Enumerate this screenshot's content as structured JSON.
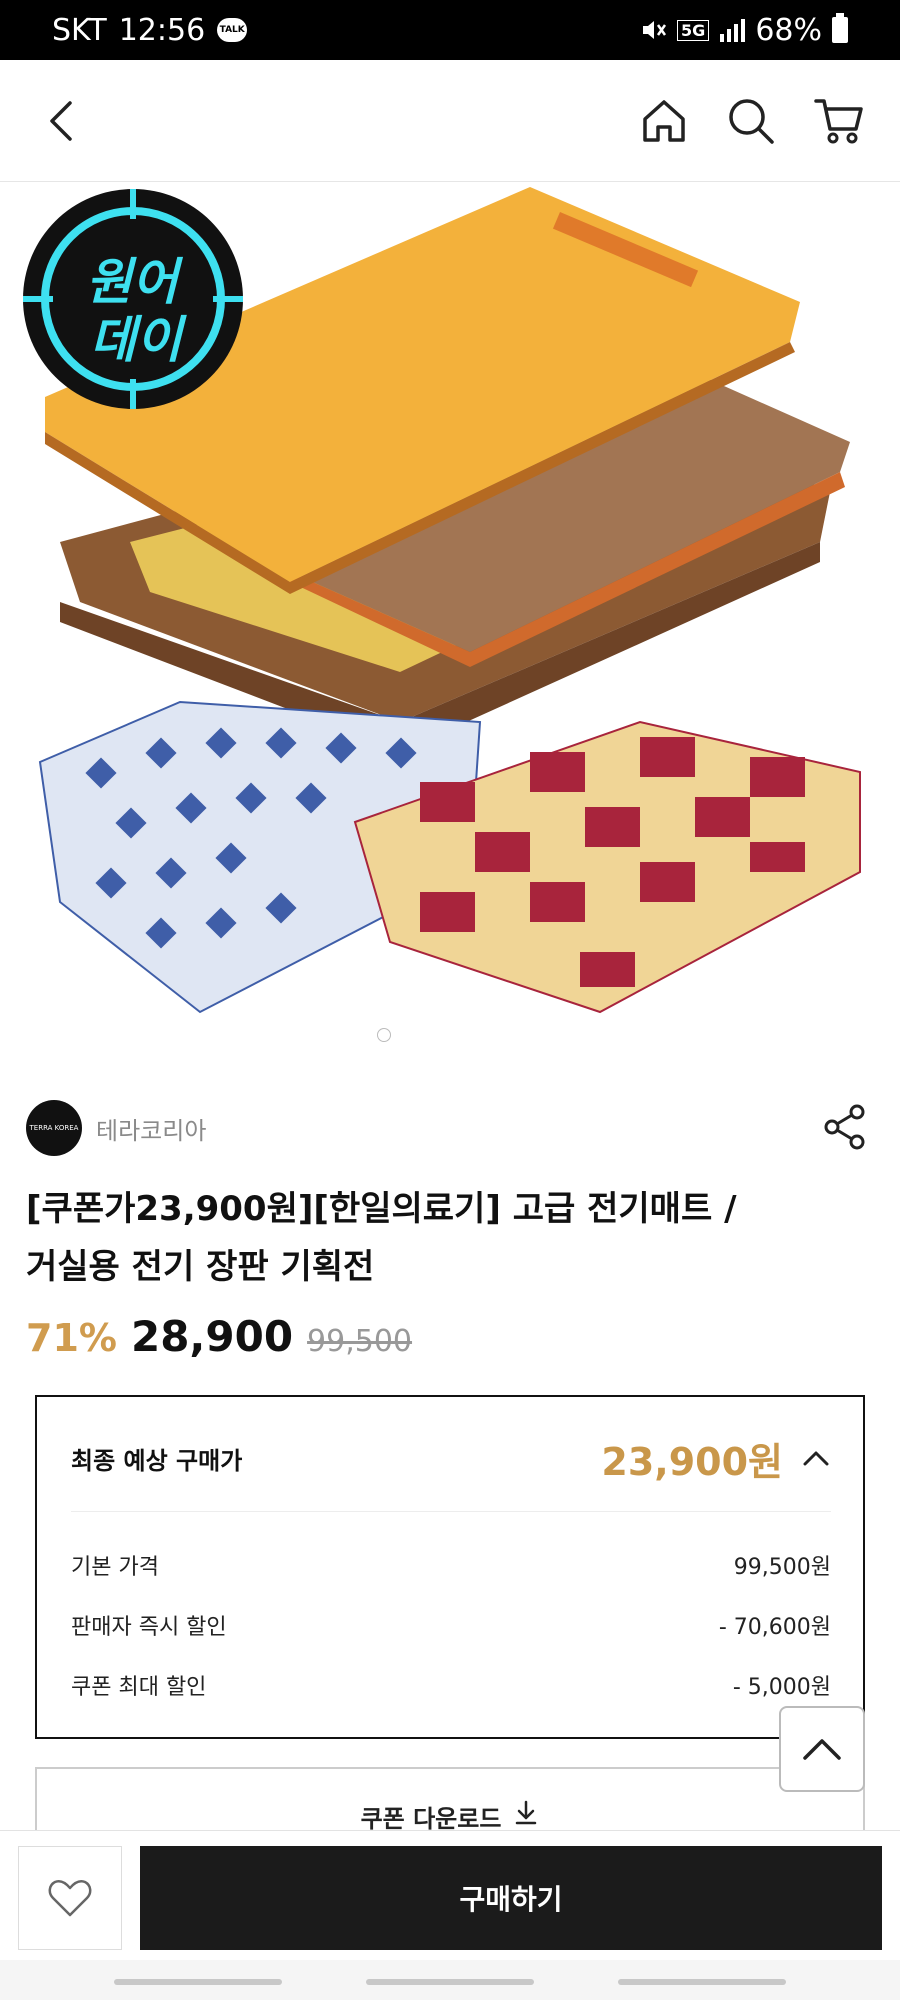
{
  "status_bar": {
    "carrier": "SKT",
    "time": "12:56",
    "talk_badge": "TALK",
    "network": "5G",
    "battery": "68%"
  },
  "header": {
    "back_icon": "chevron-left-icon",
    "home_icon": "home-icon",
    "search_icon": "search-icon",
    "cart_icon": "cart-icon"
  },
  "product": {
    "badge_line1": "원어",
    "badge_line2": "데이",
    "seller_logo": "TERRA KOREA",
    "seller_name": "테라코리아",
    "title_line1": "[쿠폰가23,900원][한일의료기] 고급 전기매트 /",
    "title_line2": "거실용 전기 장판 기획전",
    "discount": "71%",
    "price": "28,900",
    "original_price": "99,500"
  },
  "price_box": {
    "head_label": "최종 예상 구매가",
    "head_value": "23,900원",
    "rows": [
      {
        "label": "기본 가격",
        "value": "99,500원"
      },
      {
        "label": "판매자 즉시 할인",
        "value": "- 70,600원"
      },
      {
        "label": "쿠폰 최대 할인",
        "value": "- 5,000원"
      }
    ]
  },
  "coupon": {
    "label": "쿠폰 다운로드"
  },
  "bottom": {
    "buy_label": "구매하기"
  },
  "colors": {
    "accent": "#c9974a",
    "buy_bg": "#1b1b1b",
    "badge_cyan": "#3ee0f0"
  }
}
